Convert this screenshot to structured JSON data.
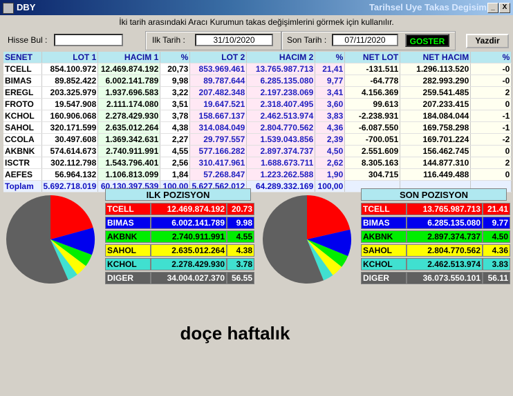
{
  "window": {
    "title": "DBY",
    "right_title": "Tarihsel Uye Takas Degisim",
    "min_label": "_",
    "close_label": "X"
  },
  "info_text": "İki tarih arasındaki  Aracı Kurumun takas değişimlerini görmek için kullanılır.",
  "form": {
    "hisse_label": "Hisse Bul :",
    "hisse_value": "",
    "ilk_label": "Ilk Tarih :",
    "ilk_value": "31/10/2020",
    "son_label": "Son Tarih :",
    "son_value": "07/11/2020",
    "goster_label": "GOSTER",
    "yazdir_label": "Yazdir"
  },
  "table": {
    "headers": [
      "SENET",
      "LOT 1",
      "HACIM 1",
      "%",
      "LOT 2",
      "HACIM 2",
      "%",
      "NET LOT",
      "NET HACIM",
      "%"
    ],
    "rows": [
      [
        "TCELL",
        "854.100.972",
        "12.469.874.192",
        "20,73",
        "853.969.461",
        "13.765.987.713",
        "21,41",
        "-131.511",
        "1.296.113.520",
        "-0"
      ],
      [
        "BIMAS",
        "89.852.422",
        "6.002.141.789",
        "9,98",
        "89.787.644",
        "6.285.135.080",
        "9,77",
        "-64.778",
        "282.993.290",
        "-0"
      ],
      [
        "EREGL",
        "203.325.979",
        "1.937.696.583",
        "3,22",
        "207.482.348",
        "2.197.238.069",
        "3,41",
        "4.156.369",
        "259.541.485",
        "2"
      ],
      [
        "FROTO",
        "19.547.908",
        "2.111.174.080",
        "3,51",
        "19.647.521",
        "2.318.407.495",
        "3,60",
        "99.613",
        "207.233.415",
        "0"
      ],
      [
        "KCHOL",
        "160.906.068",
        "2.278.429.930",
        "3,78",
        "158.667.137",
        "2.462.513.974",
        "3,83",
        "-2.238.931",
        "184.084.044",
        "-1"
      ],
      [
        "SAHOL",
        "320.171.599",
        "2.635.012.264",
        "4,38",
        "314.084.049",
        "2.804.770.562",
        "4,36",
        "-6.087.550",
        "169.758.298",
        "-1"
      ],
      [
        "CCOLA",
        "30.497.608",
        "1.369.342.631",
        "2,27",
        "29.797.557",
        "1.539.043.856",
        "2,39",
        "-700.051",
        "169.701.224",
        "-2"
      ],
      [
        "AKBNK",
        "574.614.673",
        "2.740.911.991",
        "4,55",
        "577.166.282",
        "2.897.374.737",
        "4,50",
        "2.551.609",
        "156.462.745",
        "0"
      ],
      [
        "ISCTR",
        "302.112.798",
        "1.543.796.401",
        "2,56",
        "310.417.961",
        "1.688.673.711",
        "2,62",
        "8.305.163",
        "144.877.310",
        "2"
      ],
      [
        "AEFES",
        "56.964.132",
        "1.106.813.099",
        "1,84",
        "57.268.847",
        "1.223.262.588",
        "1,90",
        "304.715",
        "116.449.488",
        "0"
      ]
    ],
    "total": [
      "Toplam",
      "5.692.718.019",
      "60.130.397.539",
      "100,00",
      "5.627.562.012",
      "64.289.332.169",
      "100,00",
      "",
      "",
      ""
    ]
  },
  "ilk_pozisyon": {
    "title": "ILK POZISYON",
    "rows": [
      {
        "name": "TCELL",
        "value": "12.469.874.192",
        "pct": "20.73",
        "color": "#ff0000",
        "text": "#ffffff"
      },
      {
        "name": "BIMAS",
        "value": "6.002.141.789",
        "pct": "9.98",
        "color": "#0000ee",
        "text": "#ffffff"
      },
      {
        "name": "AKBNK",
        "value": "2.740.911.991",
        "pct": "4.55",
        "color": "#00ee00",
        "text": "#000000"
      },
      {
        "name": "SAHOL",
        "value": "2.635.012.264",
        "pct": "4.38",
        "color": "#ffff00",
        "text": "#000000"
      },
      {
        "name": "KCHOL",
        "value": "2.278.429.930",
        "pct": "3.78",
        "color": "#40e0d0",
        "text": "#000000"
      },
      {
        "name": "DIGER",
        "value": "34.004.027.370",
        "pct": "56.55",
        "color": "#606060",
        "text": "#ffffff"
      }
    ]
  },
  "son_pozisyon": {
    "title": "SON POZISYON",
    "rows": [
      {
        "name": "TCELL",
        "value": "13.765.987.713",
        "pct": "21.41",
        "color": "#ff0000",
        "text": "#ffffff"
      },
      {
        "name": "BIMAS",
        "value": "6.285.135.080",
        "pct": "9.77",
        "color": "#0000ee",
        "text": "#ffffff"
      },
      {
        "name": "AKBNK",
        "value": "2.897.374.737",
        "pct": "4.50",
        "color": "#00ee00",
        "text": "#000000"
      },
      {
        "name": "SAHOL",
        "value": "2.804.770.562",
        "pct": "4.36",
        "color": "#ffff00",
        "text": "#000000"
      },
      {
        "name": "KCHOL",
        "value": "2.462.513.974",
        "pct": "3.83",
        "color": "#40e0d0",
        "text": "#000000"
      },
      {
        "name": "DIGER",
        "value": "36.073.550.101",
        "pct": "56.11",
        "color": "#606060",
        "text": "#ffffff"
      }
    ]
  },
  "chart_data": [
    {
      "type": "pie",
      "categories": [
        "TCELL",
        "BIMAS",
        "AKBNK",
        "SAHOL",
        "KCHOL",
        "DIGER"
      ],
      "values": [
        20.73,
        9.98,
        4.55,
        4.38,
        3.78,
        56.55
      ],
      "colors": [
        "#ff0000",
        "#0000ee",
        "#00ee00",
        "#ffff00",
        "#40e0d0",
        "#606060"
      ]
    },
    {
      "type": "pie",
      "categories": [
        "TCELL",
        "BIMAS",
        "AKBNK",
        "SAHOL",
        "KCHOL",
        "DIGER"
      ],
      "values": [
        21.41,
        9.77,
        4.5,
        4.36,
        3.83,
        56.11
      ],
      "colors": [
        "#ff0000",
        "#0000ee",
        "#00ee00",
        "#ffff00",
        "#40e0d0",
        "#606060"
      ]
    }
  ],
  "caption": "doçe haftalık"
}
